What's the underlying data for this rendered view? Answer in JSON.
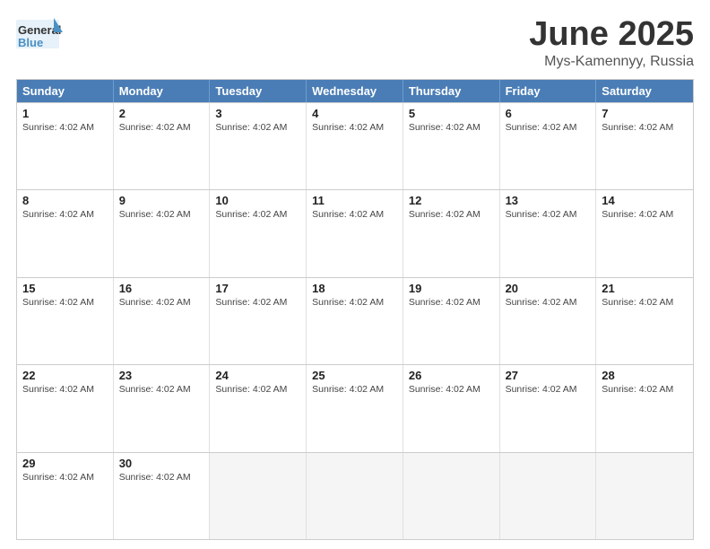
{
  "header": {
    "logo_general": "General",
    "logo_blue": "Blue",
    "month_title": "June 2025",
    "location": "Mys-Kamennyy, Russia"
  },
  "calendar": {
    "days_of_week": [
      "Sunday",
      "Monday",
      "Tuesday",
      "Wednesday",
      "Thursday",
      "Friday",
      "Saturday"
    ],
    "weeks": [
      [
        {
          "day": "1",
          "info": "Sunrise: 4:02 AM",
          "empty": false
        },
        {
          "day": "2",
          "info": "Sunrise: 4:02 AM",
          "empty": false
        },
        {
          "day": "3",
          "info": "Sunrise: 4:02 AM",
          "empty": false
        },
        {
          "day": "4",
          "info": "Sunrise: 4:02 AM",
          "empty": false
        },
        {
          "day": "5",
          "info": "Sunrise: 4:02 AM",
          "empty": false
        },
        {
          "day": "6",
          "info": "Sunrise: 4:02 AM",
          "empty": false
        },
        {
          "day": "7",
          "info": "Sunrise: 4:02 AM",
          "empty": false
        }
      ],
      [
        {
          "day": "8",
          "info": "Sunrise: 4:02 AM",
          "empty": false
        },
        {
          "day": "9",
          "info": "Sunrise: 4:02 AM",
          "empty": false
        },
        {
          "day": "10",
          "info": "Sunrise: 4:02 AM",
          "empty": false
        },
        {
          "day": "11",
          "info": "Sunrise: 4:02 AM",
          "empty": false
        },
        {
          "day": "12",
          "info": "Sunrise: 4:02 AM",
          "empty": false
        },
        {
          "day": "13",
          "info": "Sunrise: 4:02 AM",
          "empty": false
        },
        {
          "day": "14",
          "info": "Sunrise: 4:02 AM",
          "empty": false
        }
      ],
      [
        {
          "day": "15",
          "info": "Sunrise: 4:02 AM",
          "empty": false
        },
        {
          "day": "16",
          "info": "Sunrise: 4:02 AM",
          "empty": false
        },
        {
          "day": "17",
          "info": "Sunrise: 4:02 AM",
          "empty": false
        },
        {
          "day": "18",
          "info": "Sunrise: 4:02 AM",
          "empty": false
        },
        {
          "day": "19",
          "info": "Sunrise: 4:02 AM",
          "empty": false
        },
        {
          "day": "20",
          "info": "Sunrise: 4:02 AM",
          "empty": false
        },
        {
          "day": "21",
          "info": "Sunrise: 4:02 AM",
          "empty": false
        }
      ],
      [
        {
          "day": "22",
          "info": "Sunrise: 4:02 AM",
          "empty": false
        },
        {
          "day": "23",
          "info": "Sunrise: 4:02 AM",
          "empty": false
        },
        {
          "day": "24",
          "info": "Sunrise: 4:02 AM",
          "empty": false
        },
        {
          "day": "25",
          "info": "Sunrise: 4:02 AM",
          "empty": false
        },
        {
          "day": "26",
          "info": "Sunrise: 4:02 AM",
          "empty": false
        },
        {
          "day": "27",
          "info": "Sunrise: 4:02 AM",
          "empty": false
        },
        {
          "day": "28",
          "info": "Sunrise: 4:02 AM",
          "empty": false
        }
      ],
      [
        {
          "day": "29",
          "info": "Sunrise: 4:02 AM",
          "empty": false
        },
        {
          "day": "30",
          "info": "Sunrise: 4:02 AM",
          "empty": false
        },
        {
          "day": "",
          "info": "",
          "empty": true
        },
        {
          "day": "",
          "info": "",
          "empty": true
        },
        {
          "day": "",
          "info": "",
          "empty": true
        },
        {
          "day": "",
          "info": "",
          "empty": true
        },
        {
          "day": "",
          "info": "",
          "empty": true
        }
      ]
    ]
  }
}
